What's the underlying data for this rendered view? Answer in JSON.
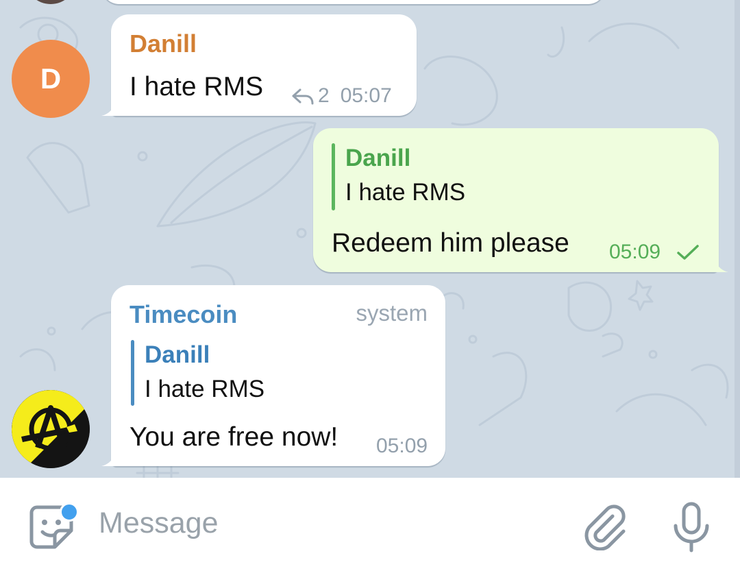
{
  "colors": {
    "accent": "#4a8cc1",
    "sender_danill": "#d27f34",
    "outgoing_bubble": "#effdde",
    "read_check": "#55ae58",
    "avatar_d": "#f08c4c",
    "unread_dot": "#42a0ee"
  },
  "messages": [
    {
      "sender": "Danill",
      "avatar_letter": "D",
      "text": "I hate RMS",
      "reply_count": "2",
      "time": "05:07",
      "icon": "reply-icon"
    },
    {
      "quote_name": "Danill",
      "quote_text": "I hate RMS",
      "text": "Redeem him please",
      "time": "05:09",
      "icon": "check-icon"
    },
    {
      "sender": "Timecoin",
      "badge": "system",
      "quote_name": "Danill",
      "quote_text": "I hate RMS",
      "text": "You are free now!",
      "time": "05:09",
      "avatar_icon": "anarchy-logo-icon"
    }
  ],
  "composer": {
    "placeholder": "Message",
    "icons": [
      "sticker-icon",
      "attach-icon",
      "microphone-icon"
    ]
  }
}
